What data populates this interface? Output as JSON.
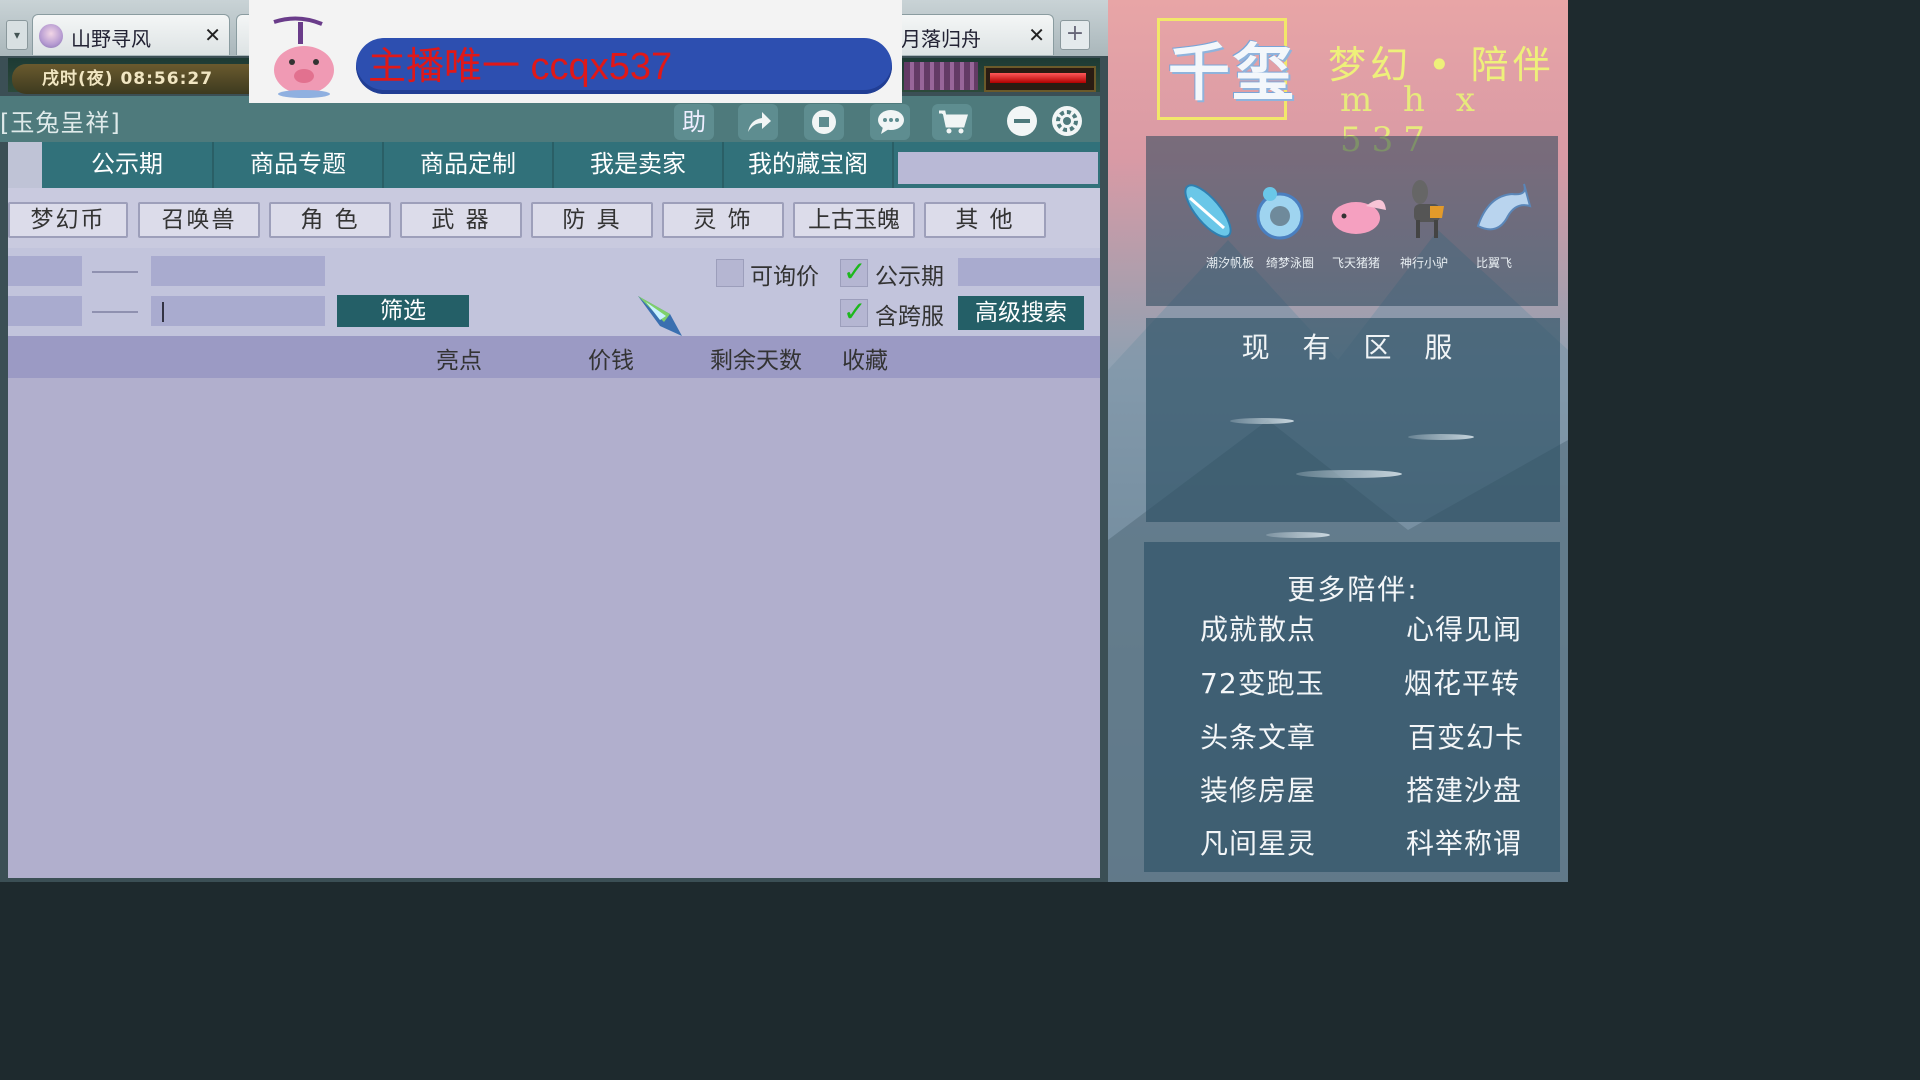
{
  "tabs": [
    {
      "label": "山野寻风",
      "close": "✕"
    },
    {
      "label": "月落归舟",
      "close": "✕"
    }
  ],
  "tab_add": "+",
  "game_time": "戌时(夜) 08:56:27",
  "overlay": {
    "text": "主播唯一  ccqx537"
  },
  "window_title": "[玉兔呈祥]",
  "toolbar": {
    "help": "助"
  },
  "nav_tabs": [
    "公示期",
    "商品专题",
    "商品定制",
    "我是卖家",
    "我的藏宝阁"
  ],
  "categories": [
    "梦幻币",
    "召唤兽",
    "角 色",
    "武 器",
    "防 具",
    "灵 饰",
    "上古玉魄",
    "其 他"
  ],
  "filters": {
    "filter_button": "筛选",
    "inquiry_label": "可询价",
    "inquiry_checked": false,
    "publicity_label": "公示期",
    "publicity_checked": true,
    "cross_server_label": "含跨服",
    "cross_server_checked": true,
    "advanced_search": "高级搜索"
  },
  "table": {
    "columns": [
      "亮点",
      "价钱",
      "剩余天数",
      "收藏"
    ],
    "rows": []
  },
  "side": {
    "logo": "千玺",
    "title": "梦幻 • 陪伴",
    "subtitle": "m h x 537",
    "pets": [
      "潮汐帆板",
      "绮梦泳圈",
      "飞天猪猪",
      "神行小驴",
      "比翼飞"
    ],
    "servers_title": "现 有 区 服",
    "more_title": "更多陪伴:",
    "more_items": [
      [
        "成就散点",
        "心得见闻"
      ],
      [
        "72变跑玉",
        "烟花平转"
      ],
      [
        "头条文章",
        "百变幻卡"
      ],
      [
        "装修房屋",
        "搭建沙盘"
      ],
      [
        "凡间星灵",
        "科举称谓"
      ]
    ]
  },
  "colors": {
    "accent_teal": "#245f67",
    "nav_bg": "#31717a",
    "list_bg": "#b1afcd",
    "overlay_bubble": "#2d4fb0",
    "overlay_text": "#e01818",
    "side_title": "#eef07a"
  }
}
